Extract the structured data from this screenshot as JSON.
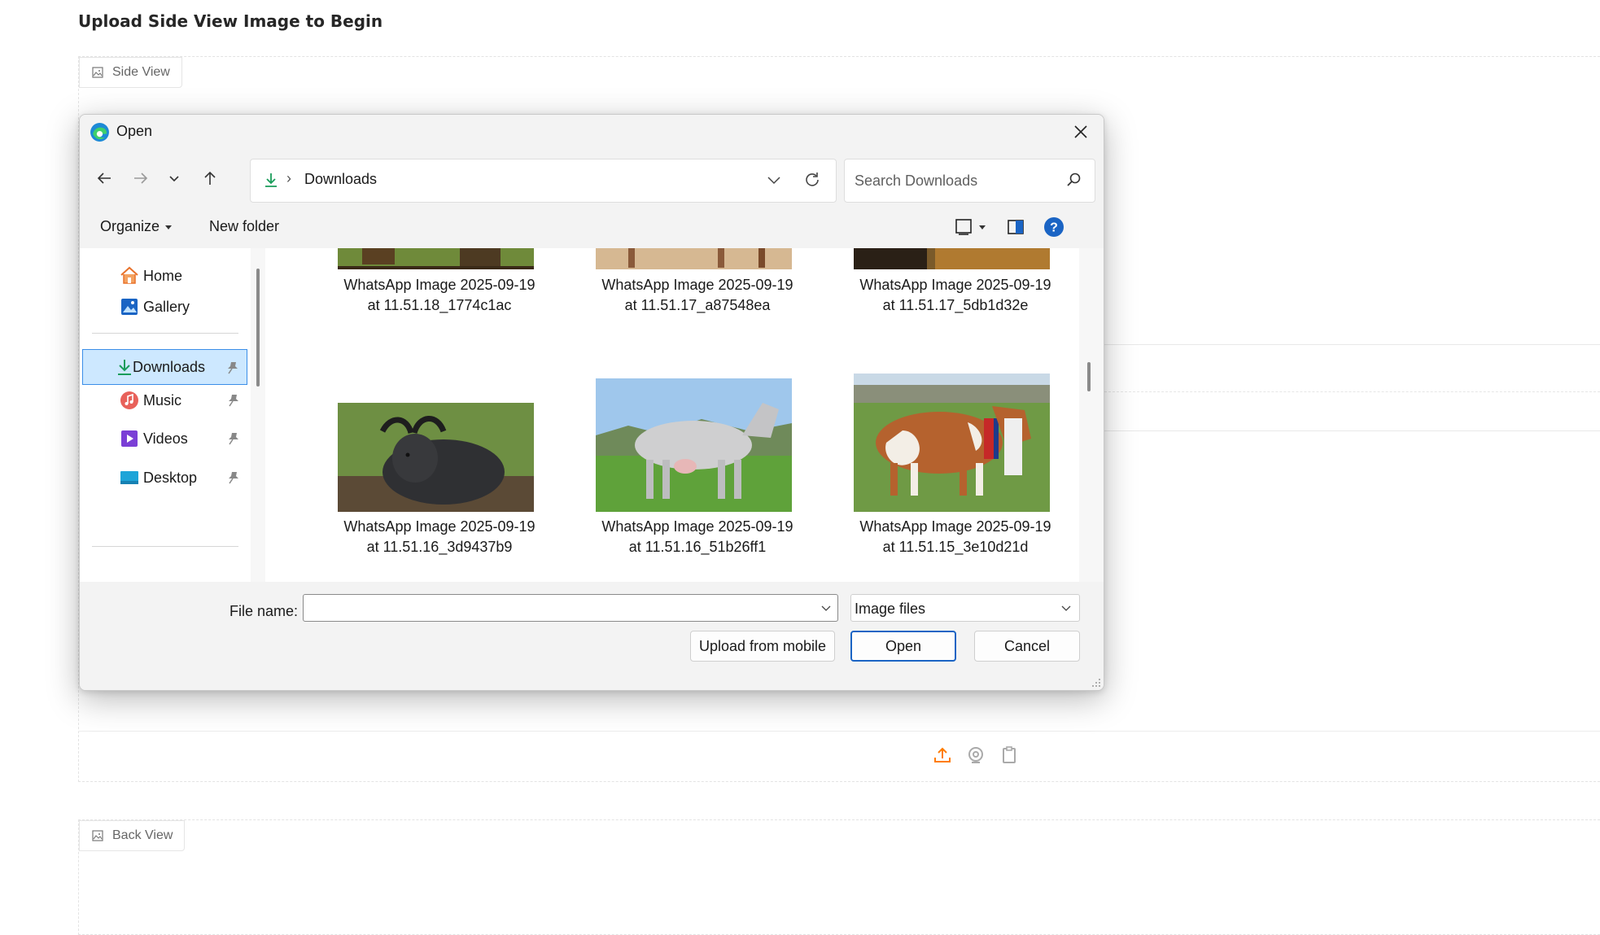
{
  "page": {
    "heading": "Upload Side View Image to Begin",
    "side_view_label": "Side View",
    "back_view_label": "Back View"
  },
  "dialog": {
    "title": "Open",
    "address": {
      "crumb": "Downloads"
    },
    "search": {
      "placeholder": "Search Downloads"
    },
    "commands": {
      "organize": "Organize",
      "new_folder": "New folder"
    },
    "sidebar": [
      {
        "label": "Home",
        "icon": "home-icon"
      },
      {
        "label": "Gallery",
        "icon": "gallery-icon"
      },
      {
        "label": "Downloads",
        "icon": "download-icon",
        "selected": true
      },
      {
        "label": "Music",
        "icon": "music-icon"
      },
      {
        "label": "Videos",
        "icon": "videos-icon"
      },
      {
        "label": "Desktop",
        "icon": "desktop-icon"
      }
    ],
    "files": [
      {
        "line1": "WhatsApp Image 2025-09-19",
        "line2": "at 11.51.18_1774c1ac"
      },
      {
        "line1": "WhatsApp Image 2025-09-19",
        "line2": "at 11.51.17_a87548ea"
      },
      {
        "line1": "WhatsApp Image 2025-09-19",
        "line2": "at 11.51.17_5db1d32e"
      },
      {
        "line1": "WhatsApp Image 2025-09-19",
        "line2": "at 11.51.16_3d9437b9"
      },
      {
        "line1": "WhatsApp Image 2025-09-19",
        "line2": "at 11.51.16_51b26ff1"
      },
      {
        "line1": "WhatsApp Image 2025-09-19",
        "line2": "at 11.51.15_3e10d21d"
      }
    ],
    "footer": {
      "file_name_label": "File name:",
      "file_name_value": "",
      "file_type": "Image files",
      "upload_mobile": "Upload from mobile",
      "open": "Open",
      "cancel": "Cancel"
    }
  },
  "colors": {
    "accent": "#1a64c4",
    "selection": "#cde8ff",
    "upload_orange": "#ff7c00"
  }
}
